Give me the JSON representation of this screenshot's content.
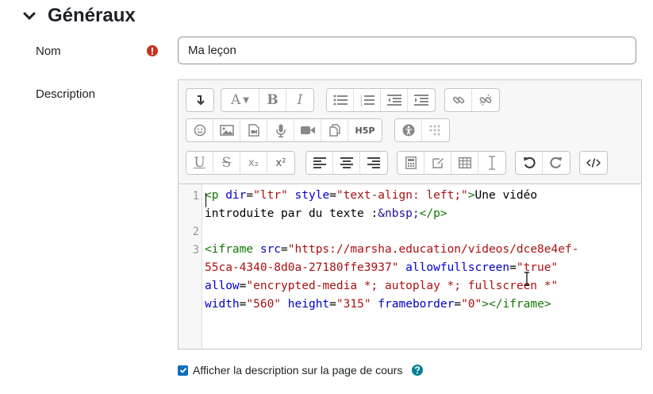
{
  "section": {
    "title": "Généraux"
  },
  "name_field": {
    "label": "Nom",
    "value": "Ma leçon"
  },
  "description_field": {
    "label": "Description"
  },
  "toolbar": {
    "row1": [
      {
        "icon": "collapse-icon"
      },
      {
        "icon": "font-style-icon",
        "text": "A"
      },
      {
        "icon": "bold-icon",
        "text": "B"
      },
      {
        "icon": "italic-icon",
        "text": "I"
      },
      {
        "icon": "unordered-list-icon"
      },
      {
        "icon": "ordered-list-icon"
      },
      {
        "icon": "outdent-icon"
      },
      {
        "icon": "indent-icon"
      },
      {
        "icon": "link-icon"
      },
      {
        "icon": "unlink-icon"
      }
    ],
    "row2": [
      {
        "icon": "emoticon-icon"
      },
      {
        "icon": "image-icon"
      },
      {
        "icon": "media-icon"
      },
      {
        "icon": "record-audio-icon"
      },
      {
        "icon": "record-video-icon"
      },
      {
        "icon": "manage-files-icon"
      },
      {
        "icon": "h5p-icon",
        "text": "H5P"
      },
      {
        "icon": "accessibility-checker-icon"
      },
      {
        "icon": "screenreader-helper-icon"
      }
    ],
    "row3": [
      {
        "icon": "underline-icon",
        "text": "U"
      },
      {
        "icon": "strikethrough-icon",
        "text": "S"
      },
      {
        "icon": "subscript-icon",
        "text": "x₂"
      },
      {
        "icon": "superscript-icon",
        "text": "x²"
      },
      {
        "icon": "align-left-icon"
      },
      {
        "icon": "align-center-icon"
      },
      {
        "icon": "align-right-icon"
      },
      {
        "icon": "equation-icon"
      },
      {
        "icon": "special-character-icon"
      },
      {
        "icon": "table-icon"
      },
      {
        "icon": "clear-formatting-icon"
      },
      {
        "icon": "undo-icon"
      },
      {
        "icon": "redo-icon"
      },
      {
        "icon": "html-source-icon"
      }
    ]
  },
  "code": {
    "line_numbers": [
      "1",
      "2",
      "3"
    ],
    "line1a": [
      {
        "text": "<p",
        "cls": "t"
      },
      {
        "text": " ",
        "cls": ""
      },
      {
        "text": "dir",
        "cls": "a"
      },
      {
        "text": "=",
        "cls": ""
      },
      {
        "text": "\"ltr\"",
        "cls": "s"
      },
      {
        "text": " ",
        "cls": ""
      },
      {
        "text": "style",
        "cls": "a"
      },
      {
        "text": "=",
        "cls": ""
      },
      {
        "text": "\"text-align: left;\"",
        "cls": "s"
      },
      {
        "text": ">",
        "cls": "t"
      },
      {
        "text": "Une vidéo",
        "cls": ""
      }
    ],
    "line1b": [
      {
        "text": "introduite par du texte :",
        "cls": ""
      },
      {
        "text": "&nbsp;",
        "cls": "e"
      },
      {
        "text": "</p>",
        "cls": "t"
      }
    ],
    "line3a": [
      {
        "text": "<iframe",
        "cls": "t"
      },
      {
        "text": " ",
        "cls": ""
      },
      {
        "text": "src",
        "cls": "a"
      },
      {
        "text": "=",
        "cls": ""
      },
      {
        "text": "\"https://marsha.education/videos/dce8e4ef-",
        "cls": "s"
      }
    ],
    "line3b": [
      {
        "text": "55ca-4340-8d0a-27180ffe3937\"",
        "cls": "s"
      },
      {
        "text": " ",
        "cls": ""
      },
      {
        "text": "allowfullscreen",
        "cls": "a"
      },
      {
        "text": "=",
        "cls": ""
      },
      {
        "text": "\"true\"",
        "cls": "s"
      }
    ],
    "line3c": [
      {
        "text": "allow",
        "cls": "a"
      },
      {
        "text": "=",
        "cls": ""
      },
      {
        "text": "\"encrypted-media *; autoplay *; fullscreen *\"",
        "cls": "s"
      }
    ],
    "line3d": [
      {
        "text": "width",
        "cls": "a"
      },
      {
        "text": "=",
        "cls": ""
      },
      {
        "text": "\"560\"",
        "cls": "s"
      },
      {
        "text": " ",
        "cls": ""
      },
      {
        "text": "height",
        "cls": "a"
      },
      {
        "text": "=",
        "cls": ""
      },
      {
        "text": "\"315\"",
        "cls": "s"
      },
      {
        "text": " ",
        "cls": ""
      },
      {
        "text": "frameborder",
        "cls": "a"
      },
      {
        "text": "=",
        "cls": ""
      },
      {
        "text": "\"0\"",
        "cls": "s"
      },
      {
        "text": "></iframe>",
        "cls": "t"
      }
    ]
  },
  "show_description": {
    "label": "Afficher la description sur la page de cours",
    "checked": true
  },
  "colors": {
    "accent": "#0f6cbf",
    "required": "#ca3120",
    "help": "#008196"
  }
}
